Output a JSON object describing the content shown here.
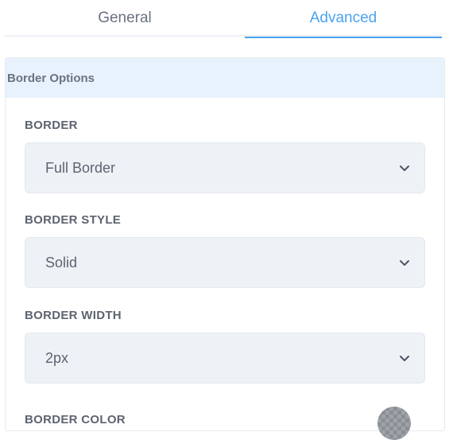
{
  "tabs": {
    "general_label": "General",
    "advanced_label": "Advanced",
    "active": "Advanced"
  },
  "section": {
    "title": "Border Options"
  },
  "fields": {
    "border": {
      "label": "BORDER",
      "value": "Full Border"
    },
    "border_style": {
      "label": "BORDER STYLE",
      "value": "Solid"
    },
    "border_width": {
      "label": "BORDER WIDTH",
      "value": "2px"
    },
    "border_color": {
      "label": "BORDER COLOR"
    }
  },
  "icons": {
    "dropdown": "chevron-down-icon"
  },
  "colors": {
    "accent": "#4aa3f0",
    "section_header_bg": "#e8f2fc",
    "select_bg": "#eef2f7",
    "label_text": "#5d6470"
  }
}
